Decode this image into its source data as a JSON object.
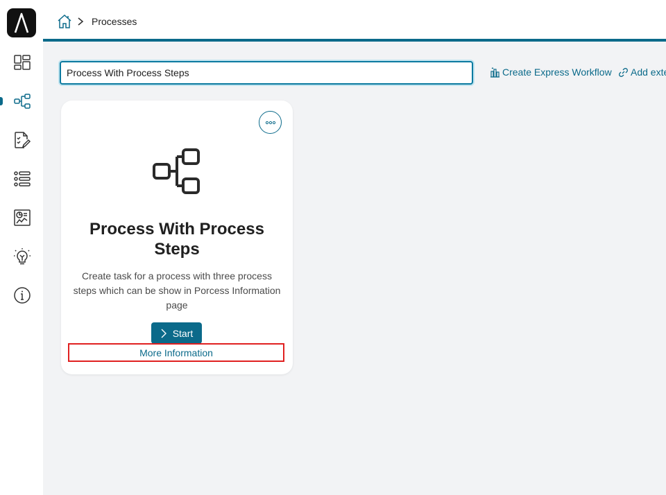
{
  "breadcrumb": {
    "current": "Processes"
  },
  "search": {
    "value": "Process With Process Steps"
  },
  "actions": {
    "express_workflow": "Create Express Workflow",
    "add_external": "Add exte"
  },
  "card": {
    "title": "Process With Process Steps",
    "description": "Create task for a process with three process steps which can be show in Porcess Information page",
    "start_label": "Start",
    "more_info_label": "More Information"
  },
  "colors": {
    "accent": "#0b6a8a",
    "highlight": "#e02020"
  }
}
